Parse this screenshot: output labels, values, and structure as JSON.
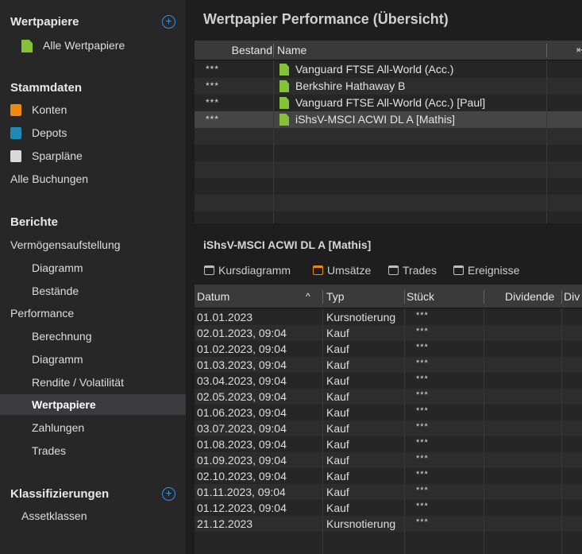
{
  "sidebar": {
    "wertpapiere_header": "Wertpapiere",
    "alle_wertpapiere": "Alle Wertpapiere",
    "stammdaten_header": "Stammdaten",
    "konten": "Konten",
    "depots": "Depots",
    "sparplaene": "Sparpläne",
    "alle_buchungen": "Alle Buchungen",
    "berichte_header": "Berichte",
    "vermoegensaufstellung": "Vermögensaufstellung",
    "diagramm1": "Diagramm",
    "bestaende": "Bestände",
    "performance": "Performance",
    "berechnung": "Berechnung",
    "diagramm2": "Diagramm",
    "rendite": "Rendite / Volatilität",
    "wertpapiere_selected": "Wertpapiere",
    "zahlungen": "Zahlungen",
    "trades": "Trades",
    "klassifizierungen_header": "Klassifizierungen",
    "assetklassen": "Assetklassen",
    "plus": "+"
  },
  "main": {
    "title": "Wertpapier Performance (Übersicht)",
    "top_table": {
      "headers": {
        "bestand": "Bestand",
        "name": "Name"
      },
      "rows": [
        {
          "bestand": "***",
          "name": "Vanguard FTSE All-World (Acc.)"
        },
        {
          "bestand": "***",
          "name": "Berkshire Hathaway B"
        },
        {
          "bestand": "***",
          "name": "Vanguard FTSE All-World (Acc.) [Paul]"
        },
        {
          "bestand": "***",
          "name": "iShsV-MSCI ACWI DL A [Mathis]"
        }
      ]
    },
    "detail_title": "iShsV-MSCI ACWI DL A [Mathis]",
    "tabs": [
      "Kursdiagramm",
      "Umsätze",
      "Trades",
      "Ereignisse"
    ],
    "bottom_table": {
      "headers": {
        "datum": "Datum",
        "sort": "^",
        "typ": "Typ",
        "stueck": "Stück",
        "dividende": "Dividende",
        "div": "Div"
      },
      "rows": [
        {
          "datum": "01.01.2023",
          "typ": "Kursnotierung",
          "stueck": "***"
        },
        {
          "datum": "02.01.2023, 09:04",
          "typ": "Kauf",
          "stueck": "***"
        },
        {
          "datum": "01.02.2023, 09:04",
          "typ": "Kauf",
          "stueck": "***"
        },
        {
          "datum": "01.03.2023, 09:04",
          "typ": "Kauf",
          "stueck": "***"
        },
        {
          "datum": "03.04.2023, 09:04",
          "typ": "Kauf",
          "stueck": "***"
        },
        {
          "datum": "02.05.2023, 09:04",
          "typ": "Kauf",
          "stueck": "***"
        },
        {
          "datum": "01.06.2023, 09:04",
          "typ": "Kauf",
          "stueck": "***"
        },
        {
          "datum": "03.07.2023, 09:04",
          "typ": "Kauf",
          "stueck": "***"
        },
        {
          "datum": "01.08.2023, 09:04",
          "typ": "Kauf",
          "stueck": "***"
        },
        {
          "datum": "01.09.2023, 09:04",
          "typ": "Kauf",
          "stueck": "***"
        },
        {
          "datum": "02.10.2023, 09:04",
          "typ": "Kauf",
          "stueck": "***"
        },
        {
          "datum": "01.11.2023, 09:04",
          "typ": "Kauf",
          "stueck": "***"
        },
        {
          "datum": "01.12.2023, 09:04",
          "typ": "Kauf",
          "stueck": "***"
        },
        {
          "datum": "21.12.2023",
          "typ": "Kursnotierung",
          "stueck": "***"
        }
      ]
    }
  },
  "colors": {
    "accent_blue": "#3d8fe0",
    "konten_orange": "#f0890e",
    "depots_blue": "#1e8ab8",
    "doc_green": "#86c235"
  }
}
